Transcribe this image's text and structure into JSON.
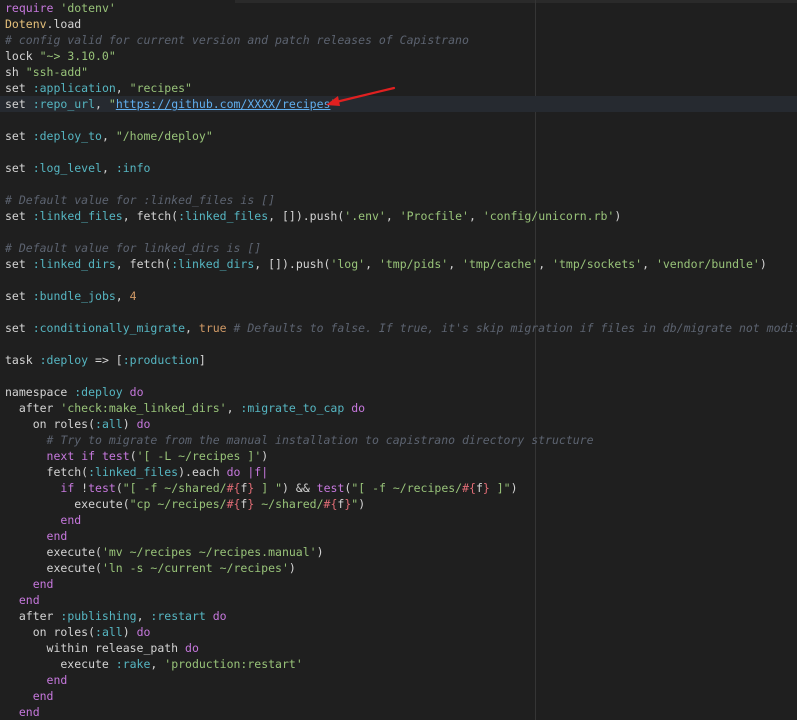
{
  "editor": {
    "accent": "#e02020",
    "lines": [
      [
        {
          "c": "kw",
          "t": "require"
        },
        {
          "c": "",
          "t": " "
        },
        {
          "c": "str",
          "t": "'dotenv'"
        }
      ],
      [
        {
          "c": "const",
          "t": "Dotenv"
        },
        {
          "c": "",
          "t": ".load"
        }
      ],
      [
        {
          "c": "cm",
          "t": "# config valid for current version and patch releases of Capistrano"
        }
      ],
      [
        {
          "c": "",
          "t": "lock "
        },
        {
          "c": "str",
          "t": "\"~> 3.10.0\""
        }
      ],
      [
        {
          "c": "",
          "t": "sh "
        },
        {
          "c": "str",
          "t": "\"ssh-add\""
        }
      ],
      [
        {
          "c": "",
          "t": "set "
        },
        {
          "c": "sym",
          "t": ":application"
        },
        {
          "c": "",
          "t": ", "
        },
        {
          "c": "str",
          "t": "\"recipes\""
        }
      ],
      [
        {
          "c": "",
          "t": "set "
        },
        {
          "c": "sym",
          "t": ":repo_url"
        },
        {
          "c": "",
          "t": ", "
        },
        {
          "c": "str",
          "t": "\""
        },
        {
          "c": "url",
          "t": "https://github.com/XXXX/recipes"
        },
        {
          "c": "str",
          "t": "\""
        }
      ],
      [],
      [
        {
          "c": "",
          "t": "set "
        },
        {
          "c": "sym",
          "t": ":deploy_to"
        },
        {
          "c": "",
          "t": ", "
        },
        {
          "c": "str",
          "t": "\"/home/deploy\""
        }
      ],
      [],
      [
        {
          "c": "",
          "t": "set "
        },
        {
          "c": "sym",
          "t": ":log_level"
        },
        {
          "c": "",
          "t": ", "
        },
        {
          "c": "sym",
          "t": ":info"
        }
      ],
      [],
      [
        {
          "c": "cm",
          "t": "# Default value for :linked_files is []"
        }
      ],
      [
        {
          "c": "",
          "t": "set "
        },
        {
          "c": "sym",
          "t": ":linked_files"
        },
        {
          "c": "",
          "t": ", fetch("
        },
        {
          "c": "sym",
          "t": ":linked_files"
        },
        {
          "c": "",
          "t": ", []).push("
        },
        {
          "c": "str",
          "t": "'.env'"
        },
        {
          "c": "",
          "t": ", "
        },
        {
          "c": "str",
          "t": "'Procfile'"
        },
        {
          "c": "",
          "t": ", "
        },
        {
          "c": "str",
          "t": "'config/unicorn.rb'"
        },
        {
          "c": "",
          "t": ")"
        }
      ],
      [],
      [
        {
          "c": "cm",
          "t": "# Default value for linked_dirs is []"
        }
      ],
      [
        {
          "c": "",
          "t": "set "
        },
        {
          "c": "sym",
          "t": ":linked_dirs"
        },
        {
          "c": "",
          "t": ", fetch("
        },
        {
          "c": "sym",
          "t": ":linked_dirs"
        },
        {
          "c": "",
          "t": ", []).push("
        },
        {
          "c": "str",
          "t": "'log'"
        },
        {
          "c": "",
          "t": ", "
        },
        {
          "c": "str",
          "t": "'tmp/pids'"
        },
        {
          "c": "",
          "t": ", "
        },
        {
          "c": "str",
          "t": "'tmp/cache'"
        },
        {
          "c": "",
          "t": ", "
        },
        {
          "c": "str",
          "t": "'tmp/sockets'"
        },
        {
          "c": "",
          "t": ", "
        },
        {
          "c": "str",
          "t": "'vendor/bundle'"
        },
        {
          "c": "",
          "t": ")"
        }
      ],
      [],
      [
        {
          "c": "",
          "t": "set "
        },
        {
          "c": "sym",
          "t": ":bundle_jobs"
        },
        {
          "c": "",
          "t": ", "
        },
        {
          "c": "num",
          "t": "4"
        }
      ],
      [],
      [
        {
          "c": "",
          "t": "set "
        },
        {
          "c": "sym",
          "t": ":conditionally_migrate"
        },
        {
          "c": "",
          "t": ", "
        },
        {
          "c": "num",
          "t": "true"
        },
        {
          "c": "",
          "t": " "
        },
        {
          "c": "cm",
          "t": "# Defaults to false. If true, it's skip migration if files in db/migrate not modified"
        }
      ],
      [],
      [
        {
          "c": "",
          "t": "task "
        },
        {
          "c": "sym",
          "t": ":deploy"
        },
        {
          "c": "",
          "t": " => ["
        },
        {
          "c": "sym",
          "t": ":production"
        },
        {
          "c": "",
          "t": "]"
        }
      ],
      [],
      [
        {
          "c": "",
          "t": "namespace "
        },
        {
          "c": "sym",
          "t": ":deploy"
        },
        {
          "c": "",
          "t": " "
        },
        {
          "c": "kw",
          "t": "do"
        }
      ],
      [
        {
          "c": "",
          "t": "  after "
        },
        {
          "c": "str",
          "t": "'check:make_linked_dirs'"
        },
        {
          "c": "",
          "t": ", "
        },
        {
          "c": "sym",
          "t": ":migrate_to_cap"
        },
        {
          "c": "",
          "t": " "
        },
        {
          "c": "kw",
          "t": "do"
        }
      ],
      [
        {
          "c": "",
          "t": "    on roles("
        },
        {
          "c": "sym",
          "t": ":all"
        },
        {
          "c": "",
          "t": ") "
        },
        {
          "c": "kw",
          "t": "do"
        }
      ],
      [
        {
          "c": "",
          "t": "      "
        },
        {
          "c": "cm",
          "t": "# Try to migrate from the manual installation to capistrano directory structure"
        }
      ],
      [
        {
          "c": "",
          "t": "      "
        },
        {
          "c": "kw",
          "t": "next"
        },
        {
          "c": "",
          "t": " "
        },
        {
          "c": "kw",
          "t": "if"
        },
        {
          "c": "",
          "t": " "
        },
        {
          "c": "kw",
          "t": "test"
        },
        {
          "c": "",
          "t": "("
        },
        {
          "c": "str",
          "t": "'[ -L ~/recipes ]'"
        },
        {
          "c": "",
          "t": ")"
        }
      ],
      [
        {
          "c": "",
          "t": "      fetch("
        },
        {
          "c": "sym",
          "t": ":linked_files"
        },
        {
          "c": "",
          "t": ").each "
        },
        {
          "c": "kw",
          "t": "do"
        },
        {
          "c": "",
          "t": " "
        },
        {
          "c": "kw",
          "t": "|f|"
        }
      ],
      [
        {
          "c": "",
          "t": "        "
        },
        {
          "c": "kw",
          "t": "if"
        },
        {
          "c": "",
          "t": " !"
        },
        {
          "c": "kw",
          "t": "test"
        },
        {
          "c": "",
          "t": "("
        },
        {
          "c": "str",
          "t": "\"[ -f ~/shared/"
        },
        {
          "c": "interp",
          "t": "#{"
        },
        {
          "c": "",
          "t": "f"
        },
        {
          "c": "interp",
          "t": "}"
        },
        {
          "c": "str",
          "t": " ] \""
        },
        {
          "c": "",
          "t": ") && "
        },
        {
          "c": "kw",
          "t": "test"
        },
        {
          "c": "",
          "t": "("
        },
        {
          "c": "str",
          "t": "\"[ -f ~/recipes/"
        },
        {
          "c": "interp",
          "t": "#{"
        },
        {
          "c": "",
          "t": "f"
        },
        {
          "c": "interp",
          "t": "}"
        },
        {
          "c": "str",
          "t": " ]\""
        },
        {
          "c": "",
          "t": ")"
        }
      ],
      [
        {
          "c": "",
          "t": "          execute("
        },
        {
          "c": "str",
          "t": "\"cp ~/recipes/"
        },
        {
          "c": "interp",
          "t": "#{"
        },
        {
          "c": "",
          "t": "f"
        },
        {
          "c": "interp",
          "t": "}"
        },
        {
          "c": "str",
          "t": " ~/shared/"
        },
        {
          "c": "interp",
          "t": "#{"
        },
        {
          "c": "",
          "t": "f"
        },
        {
          "c": "interp",
          "t": "}"
        },
        {
          "c": "str",
          "t": "\""
        },
        {
          "c": "",
          "t": ")"
        }
      ],
      [
        {
          "c": "",
          "t": "        "
        },
        {
          "c": "kw",
          "t": "end"
        }
      ],
      [
        {
          "c": "",
          "t": "      "
        },
        {
          "c": "kw",
          "t": "end"
        }
      ],
      [
        {
          "c": "",
          "t": "      execute("
        },
        {
          "c": "str",
          "t": "'mv ~/recipes ~/recipes.manual'"
        },
        {
          "c": "",
          "t": ")"
        }
      ],
      [
        {
          "c": "",
          "t": "      execute("
        },
        {
          "c": "str",
          "t": "'ln -s ~/current ~/recipes'"
        },
        {
          "c": "",
          "t": ")"
        }
      ],
      [
        {
          "c": "",
          "t": "    "
        },
        {
          "c": "kw",
          "t": "end"
        }
      ],
      [
        {
          "c": "",
          "t": "  "
        },
        {
          "c": "kw",
          "t": "end"
        }
      ],
      [
        {
          "c": "",
          "t": "  after "
        },
        {
          "c": "sym",
          "t": ":publishing"
        },
        {
          "c": "",
          "t": ", "
        },
        {
          "c": "sym",
          "t": ":restart"
        },
        {
          "c": "",
          "t": " "
        },
        {
          "c": "kw",
          "t": "do"
        }
      ],
      [
        {
          "c": "",
          "t": "    on roles("
        },
        {
          "c": "sym",
          "t": ":all"
        },
        {
          "c": "",
          "t": ") "
        },
        {
          "c": "kw",
          "t": "do"
        }
      ],
      [
        {
          "c": "",
          "t": "      within release_path "
        },
        {
          "c": "kw",
          "t": "do"
        }
      ],
      [
        {
          "c": "",
          "t": "        execute "
        },
        {
          "c": "sym",
          "t": ":rake"
        },
        {
          "c": "",
          "t": ", "
        },
        {
          "c": "str",
          "t": "'production:restart'"
        }
      ],
      [
        {
          "c": "",
          "t": "      "
        },
        {
          "c": "kw",
          "t": "end"
        }
      ],
      [
        {
          "c": "",
          "t": "    "
        },
        {
          "c": "kw",
          "t": "end"
        }
      ],
      [
        {
          "c": "",
          "t": "  "
        },
        {
          "c": "kw",
          "t": "end"
        }
      ]
    ]
  }
}
